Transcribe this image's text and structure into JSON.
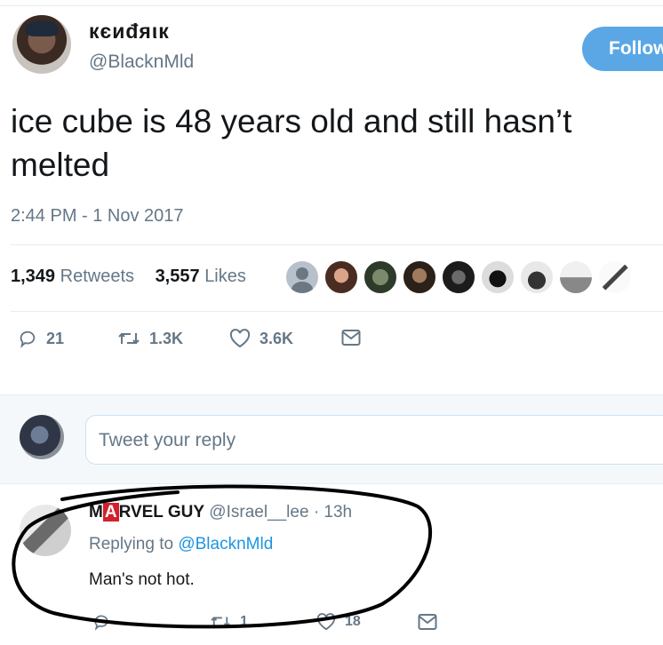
{
  "tweet": {
    "display_name": "кєиđяιк",
    "handle": "@BlacknMld",
    "follow_label": "Follow",
    "text": "ice cube is 48 years old and still hasn’t melted",
    "timestamp": "2:44 PM - 1 Nov 2017",
    "stats": {
      "retweets_count": "1,349",
      "retweets_label": "Retweets",
      "likes_count": "3,557",
      "likes_label": "Likes"
    },
    "actions": {
      "replies": "21",
      "retweets": "1.3K",
      "likes": "3.6K"
    },
    "icons": [
      "reply-icon",
      "retweet-icon",
      "like-icon",
      "message-icon"
    ]
  },
  "reply_box": {
    "placeholder": "Tweet your reply"
  },
  "reply": {
    "name_prefix": "M",
    "name_boxed": "A",
    "name_suffix": "RVEL GUY",
    "meta": "@Israel__lee · 13h",
    "replying_prefix": "Replying to",
    "replying_handle": "@BlacknMld",
    "text": "Man's not hot.",
    "actions": {
      "retweets": "1",
      "likes": "18"
    }
  },
  "colors": {
    "accent": "#1b95e0",
    "follow_button": "#5ba7e5",
    "muted": "#657786",
    "scribble": "#000000"
  }
}
